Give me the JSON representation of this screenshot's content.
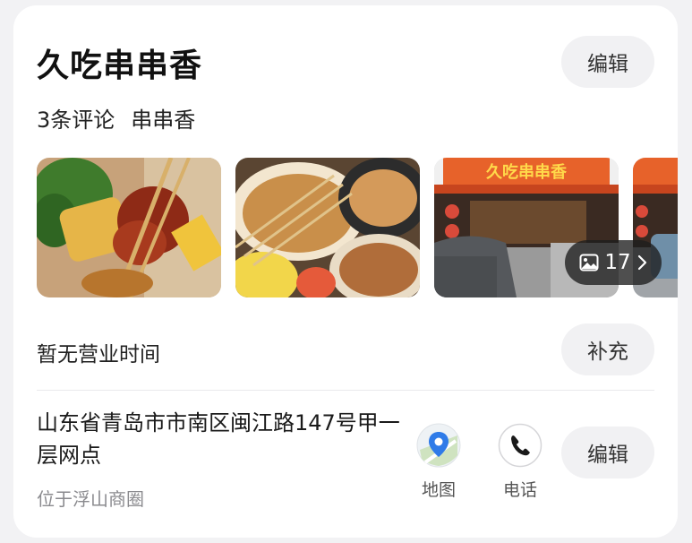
{
  "shop": {
    "name": "久吃串串香",
    "reviews": "3条评论",
    "category": "串串香",
    "edit_label": "编辑"
  },
  "photos": {
    "count": "17"
  },
  "hours": {
    "text": "暂无营业时间",
    "add_label": "补充"
  },
  "location": {
    "address": "山东省青岛市市南区闽江路147号甲一层网点",
    "area": "位于浮山商圈",
    "map_label": "地图",
    "phone_label": "电话",
    "edit_label": "编辑"
  },
  "sign": {
    "text": "久吃串串香"
  },
  "icons": {
    "photo": "image-icon",
    "chevron": "chevron-right-icon",
    "map": "map-pin-icon",
    "phone": "phone-icon"
  }
}
